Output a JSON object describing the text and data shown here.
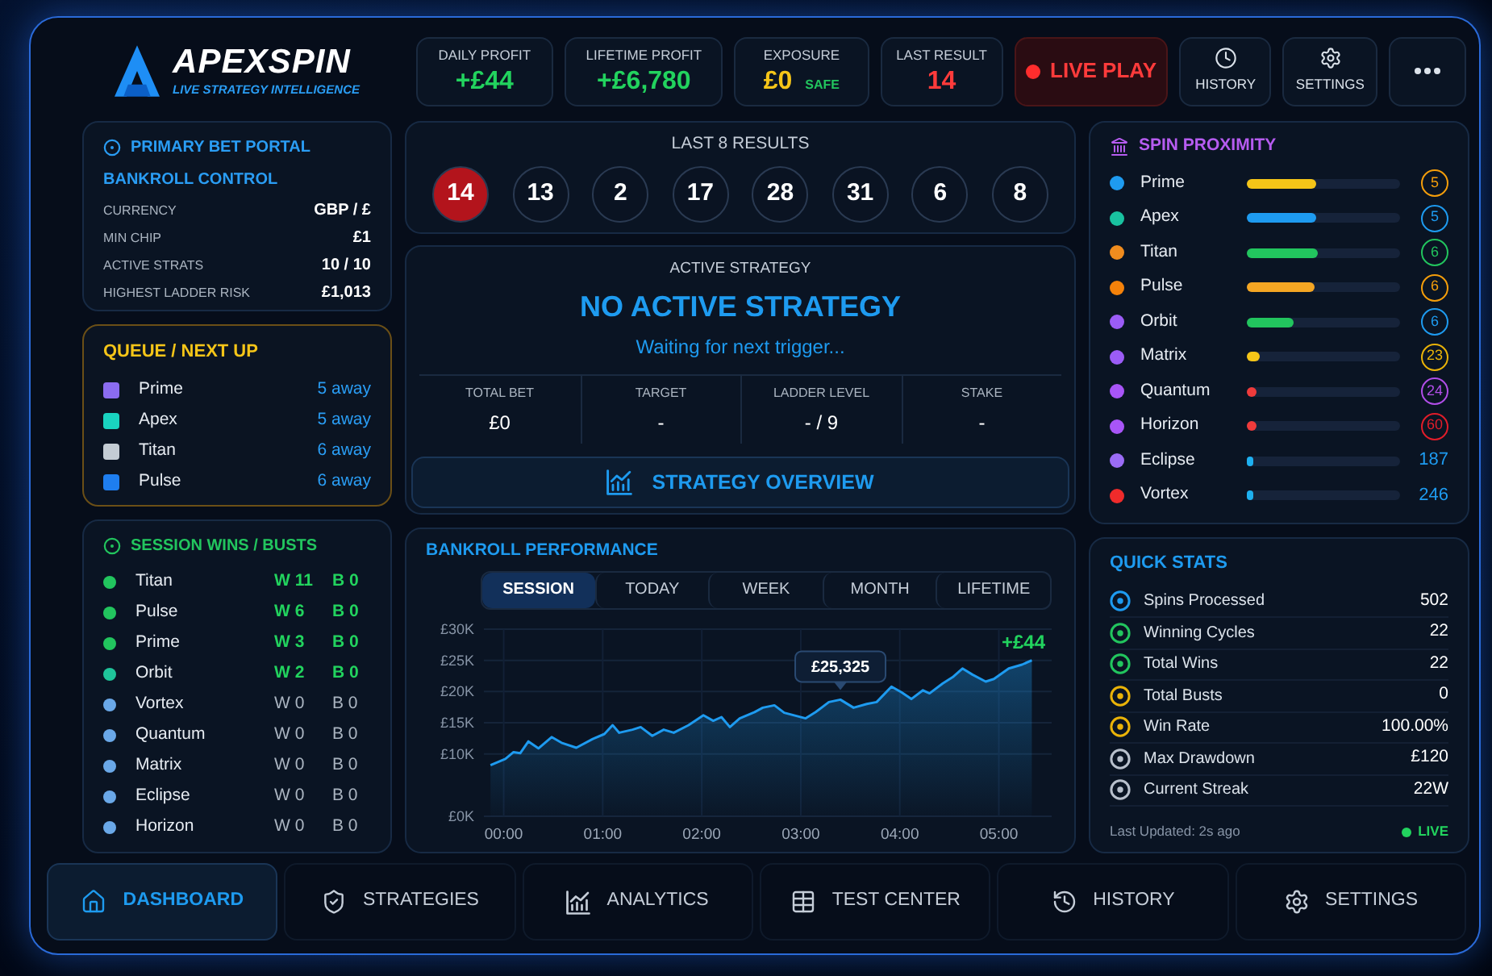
{
  "brand": {
    "name": "APEXSPIN",
    "tagline": "LIVE STRATEGY INTELLIGENCE"
  },
  "header_stats": [
    {
      "label": "DAILY PROFIT",
      "value": "+£44",
      "color": "#22d35e"
    },
    {
      "label": "LIFETIME PROFIT",
      "value": "+£6,780",
      "color": "#22d35e"
    },
    {
      "label": "EXPOSURE",
      "value": "£0",
      "color": "#f5c518",
      "badge": "SAFE"
    },
    {
      "label": "LAST RESULT",
      "value": "14",
      "color": "#ff3b3b"
    }
  ],
  "live_play": {
    "label": "LIVE PLAY",
    "on": true
  },
  "header_buttons": [
    {
      "kind": "history",
      "label": "HISTORY"
    },
    {
      "kind": "settings",
      "label": "SETTINGS"
    },
    {
      "kind": "more"
    }
  ],
  "bet_portal": {
    "title": "PRIMARY BET PORTAL",
    "subtitle": "BANKROLL CONTROL",
    "rows": [
      {
        "label": "CURRENCY",
        "value": "GBP / £"
      },
      {
        "label": "MIN CHIP",
        "value": "£1"
      },
      {
        "label": "ACTIVE STRATS",
        "value": "10 / 10"
      },
      {
        "label": "HIGHEST LADDER RISK",
        "value": "£1,013"
      }
    ]
  },
  "queue": {
    "title": "QUEUE / NEXT UP",
    "items": [
      {
        "name": "Prime",
        "color": "#8b6cf0",
        "distance": "5 away"
      },
      {
        "name": "Apex",
        "color": "#19d3c0",
        "distance": "5 away"
      },
      {
        "name": "Titan",
        "color": "#c4ccd4",
        "distance": "6 away"
      },
      {
        "name": "Pulse",
        "color": "#1e7ef0",
        "distance": "6 away"
      }
    ]
  },
  "session": {
    "title": "SESSION WINS / BUSTS",
    "rows": [
      {
        "name": "Titan",
        "color": "#22c55e",
        "wins": "W 11",
        "busts": "B 0",
        "active": true
      },
      {
        "name": "Pulse",
        "color": "#22c55e",
        "wins": "W 6",
        "busts": "B 0",
        "active": true
      },
      {
        "name": "Prime",
        "color": "#22c55e",
        "wins": "W 3",
        "busts": "B 0",
        "active": true
      },
      {
        "name": "Orbit",
        "color": "#1fc49a",
        "wins": "W 2",
        "busts": "B 0",
        "active": true
      },
      {
        "name": "Vortex",
        "color": "#6aa8e8",
        "wins": "W 0",
        "busts": "B 0",
        "active": false
      },
      {
        "name": "Quantum",
        "color": "#6aa8e8",
        "wins": "W 0",
        "busts": "B 0",
        "active": false
      },
      {
        "name": "Matrix",
        "color": "#6aa8e8",
        "wins": "W 0",
        "busts": "B 0",
        "active": false
      },
      {
        "name": "Eclipse",
        "color": "#6aa8e8",
        "wins": "W 0",
        "busts": "B 0",
        "active": false
      },
      {
        "name": "Horizon",
        "color": "#6aa8e8",
        "wins": "W 0",
        "busts": "B 0",
        "active": false
      }
    ]
  },
  "last_results": {
    "title": "LAST 8 RESULTS",
    "numbers": [
      {
        "value": "14",
        "color": "#b3141c"
      },
      {
        "value": "13",
        "color": "#0a1322"
      },
      {
        "value": "2",
        "color": "#0a1322"
      },
      {
        "value": "17",
        "color": "#0a1322"
      },
      {
        "value": "28",
        "color": "#0a1322"
      },
      {
        "value": "31",
        "color": "#0a1322"
      },
      {
        "value": "6",
        "color": "#0a1322"
      },
      {
        "value": "8",
        "color": "#0a1322"
      }
    ]
  },
  "active_strategy": {
    "heading": "ACTIVE STRATEGY",
    "status": "NO ACTIVE STRATEGY",
    "message": "Waiting for next trigger...",
    "metrics": [
      {
        "label": "TOTAL BET",
        "value": "£0"
      },
      {
        "label": "TARGET",
        "value": "-"
      },
      {
        "label": "LADDER LEVEL",
        "value": "- / 9"
      },
      {
        "label": "STAKE",
        "value": "-"
      }
    ],
    "button": "STRATEGY OVERVIEW"
  },
  "bankroll_performance": {
    "tabs": [
      {
        "label": "SESSION",
        "selected": true
      },
      {
        "label": "TODAY",
        "selected": false
      },
      {
        "label": "WEEK",
        "selected": false
      },
      {
        "label": "MONTH",
        "selected": false
      },
      {
        "label": "LIFETIME",
        "selected": false
      }
    ],
    "chart_data": {
      "type": "area",
      "title": "BANKROLL PERFORMANCE",
      "grid": true,
      "x": [
        -8,
        1,
        6,
        10,
        15,
        21,
        29,
        35,
        44,
        54,
        61,
        66,
        70,
        78,
        83,
        90,
        97,
        103,
        112,
        121,
        127,
        132,
        137,
        143,
        152,
        157,
        164,
        170,
        183,
        189,
        197,
        204,
        212,
        220,
        226,
        235,
        241,
        247,
        254,
        258,
        266,
        272,
        278,
        284,
        292,
        297,
        306,
        314,
        320
      ],
      "series": [
        {
          "color": "#1e9bf0",
          "values": [
            8.2,
            9.2,
            10.3,
            10.1,
            12.0,
            10.9,
            12.7,
            11.8,
            11.0,
            12.4,
            13.2,
            14.6,
            13.4,
            13.9,
            14.3,
            12.9,
            13.9,
            13.4,
            14.6,
            16.2,
            15.3,
            15.9,
            14.3,
            15.7,
            16.7,
            17.4,
            17.8,
            16.6,
            15.7,
            16.7,
            18.3,
            18.7,
            17.4,
            18.0,
            18.3,
            20.8,
            19.9,
            18.8,
            20.2,
            19.7,
            21.3,
            22.3,
            23.7,
            22.7,
            21.6,
            22.0,
            23.7,
            24.3,
            25.0
          ]
        }
      ],
      "xlim": [
        -12,
        332
      ],
      "ylim": [
        0,
        30
      ],
      "xticks": [
        {
          "value": 0,
          "label": "00:00"
        },
        {
          "value": 60,
          "label": "01:00"
        },
        {
          "value": 120,
          "label": "02:00"
        },
        {
          "value": 180,
          "label": "03:00"
        },
        {
          "value": 240,
          "label": "04:00"
        },
        {
          "value": 300,
          "label": "05:00"
        }
      ],
      "yticks": [
        {
          "value": 0,
          "label": "£0K"
        },
        {
          "value": 10,
          "label": "£10K"
        },
        {
          "value": 15,
          "label": "£15K"
        },
        {
          "value": 20,
          "label": "£20K"
        },
        {
          "value": 25,
          "label": "£25K"
        },
        {
          "value": 30,
          "label": "£30K"
        }
      ],
      "annotations": [
        {
          "text": "£25,325",
          "x": 204,
          "y": 18.7
        },
        "+£44"
      ]
    }
  },
  "spin_proximity": {
    "title": "SPIN PROXIMITY",
    "rows": [
      {
        "name": "Prime",
        "color": "#1e9bf0",
        "bar": {
          "level": 0.45,
          "color": "#f5c518"
        },
        "count": {
          "kind": "badge",
          "text": "5",
          "color": "#f59e0b"
        }
      },
      {
        "name": "Apex",
        "color": "#19c2a0",
        "bar": {
          "level": 0.45,
          "color": "#1e9bf0"
        },
        "count": {
          "kind": "badge",
          "text": "5",
          "color": "#1e9bf0"
        }
      },
      {
        "name": "Titan",
        "color": "#f08c1e",
        "bar": {
          "level": 0.46,
          "color": "#22c55e"
        },
        "count": {
          "kind": "badge",
          "text": "6",
          "color": "#22c55e"
        }
      },
      {
        "name": "Pulse",
        "color": "#f5820a",
        "bar": {
          "level": 0.44,
          "color": "#f5a623"
        },
        "count": {
          "kind": "badge",
          "text": "6",
          "color": "#f59e0b"
        }
      },
      {
        "name": "Orbit",
        "color": "#9b5cf6",
        "bar": {
          "level": 0.31,
          "color": "#22c55e"
        },
        "count": {
          "kind": "badge",
          "text": "6",
          "color": "#1e9bf0"
        }
      },
      {
        "name": "Matrix",
        "color": "#9b5cf6",
        "bar": {
          "level": 0.08,
          "color": "#f5c518"
        },
        "count": {
          "kind": "badge",
          "text": "23",
          "color": "#eab308"
        }
      },
      {
        "name": "Quantum",
        "color": "#a855f7",
        "bar": {
          "level": 0.06,
          "color": "#ef3b3b"
        },
        "count": {
          "kind": "badge",
          "text": "24",
          "color": "#b14ee8"
        }
      },
      {
        "name": "Horizon",
        "color": "#a855f7",
        "bar": {
          "level": 0.06,
          "color": "#ef3b3b"
        },
        "count": {
          "kind": "badge",
          "text": "60",
          "color": "#e11d2a"
        }
      },
      {
        "name": "Eclipse",
        "color": "#9b6cf6",
        "bar": {
          "level": 0.04,
          "color": "#1eb0f0"
        },
        "count": {
          "kind": "plain",
          "text": "187",
          "color": "#1e9bf0"
        }
      },
      {
        "name": "Vortex",
        "color": "#ef2b2b",
        "bar": {
          "level": 0.04,
          "color": "#1eb0f0"
        },
        "count": {
          "kind": "plain",
          "text": "246",
          "color": "#1e9bf0"
        }
      }
    ]
  },
  "quick_stats": {
    "title": "QUICK STATS",
    "rows": [
      {
        "label": "Spins Processed",
        "value": "502",
        "color": "#1e9bf0"
      },
      {
        "label": "Winning Cycles",
        "value": "22",
        "color": "#22c55e"
      },
      {
        "label": "Total Wins",
        "value": "22",
        "color": "#22c55e"
      },
      {
        "label": "Total Busts",
        "value": "0",
        "color": "#eab308"
      },
      {
        "label": "Win Rate",
        "value": "100.00%",
        "color": "#eab308"
      },
      {
        "label": "Max Drawdown",
        "value": "£120",
        "color": "#b8c0cc"
      },
      {
        "label": "Current Streak",
        "value": "22W",
        "color": "#b8c0cc"
      }
    ],
    "updated": "Last Updated: 2s ago",
    "live": {
      "label": "LIVE",
      "on": true
    }
  },
  "nav": [
    {
      "kind": "home",
      "label": "DASHBOARD",
      "selected": true
    },
    {
      "kind": "strategies",
      "label": "STRATEGIES",
      "selected": false
    },
    {
      "kind": "analytics",
      "label": "ANALYTICS",
      "selected": false
    },
    {
      "kind": "table",
      "label": "TEST CENTER",
      "selected": false
    },
    {
      "kind": "history",
      "label": "HISTORY",
      "selected": false
    },
    {
      "kind": "settings",
      "label": "SETTINGS",
      "selected": false
    }
  ]
}
